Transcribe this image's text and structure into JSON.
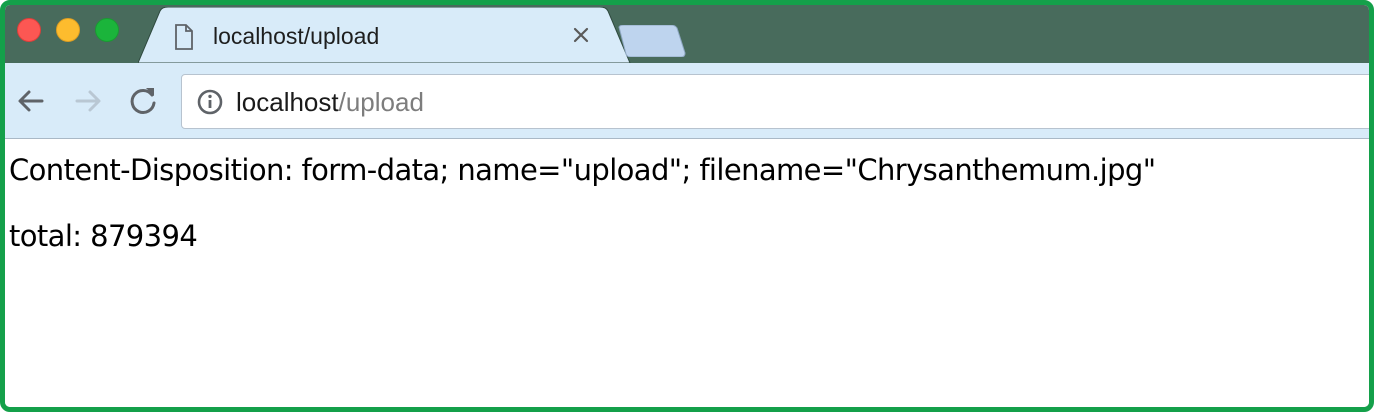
{
  "window": {
    "controls": [
      "close",
      "minimize",
      "zoom"
    ],
    "accent": "#14a04a"
  },
  "tab": {
    "title": "localhost/upload",
    "icon": "page-icon"
  },
  "toolbar": {
    "url_host": "localhost",
    "url_path": "/upload"
  },
  "page": {
    "line1": "Content-Disposition: form-data; name=\"upload\"; filename=\"Chrysanthemum.jpg\"",
    "line2": "total: 879394"
  }
}
